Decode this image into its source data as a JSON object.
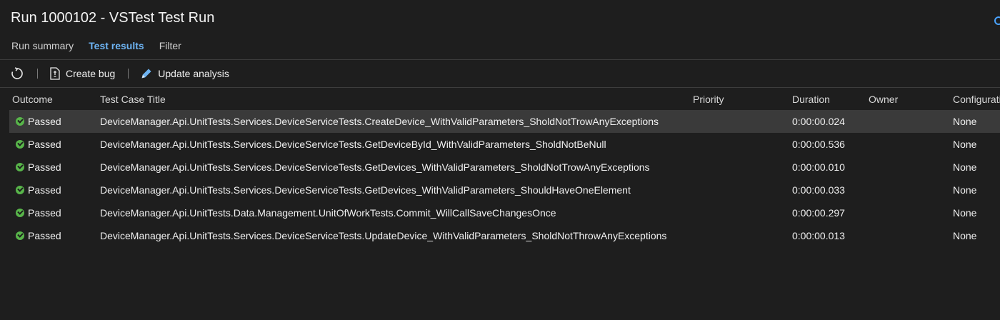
{
  "page": {
    "title": "Run 1000102 - VSTest Test Run"
  },
  "tabs": [
    {
      "label": "Run summary",
      "active": false
    },
    {
      "label": "Test results",
      "active": true
    },
    {
      "label": "Filter",
      "active": false
    }
  ],
  "toolbar": {
    "refresh_icon": "refresh-icon",
    "create_bug_label": "Create bug",
    "create_bug_icon": "bug-icon",
    "update_analysis_label": "Update analysis",
    "update_analysis_icon": "pencil-icon"
  },
  "table": {
    "columns": [
      "Outcome",
      "Test Case Title",
      "Priority",
      "Duration",
      "Owner",
      "Configuratio"
    ],
    "rows": [
      {
        "outcome": "Passed",
        "title": "DeviceManager.Api.UnitTests.Services.DeviceServiceTests.CreateDevice_WithValidParameters_SholdNotTrowAnyExceptions",
        "priority": "",
        "duration": "0:00:00.024",
        "owner": "",
        "configuration": "None",
        "selected": true
      },
      {
        "outcome": "Passed",
        "title": "DeviceManager.Api.UnitTests.Services.DeviceServiceTests.GetDeviceById_WithValidParameters_SholdNotBeNull",
        "priority": "",
        "duration": "0:00:00.536",
        "owner": "",
        "configuration": "None",
        "selected": false
      },
      {
        "outcome": "Passed",
        "title": "DeviceManager.Api.UnitTests.Services.DeviceServiceTests.GetDevices_WithValidParameters_SholdNotTrowAnyExceptions",
        "priority": "",
        "duration": "0:00:00.010",
        "owner": "",
        "configuration": "None",
        "selected": false
      },
      {
        "outcome": "Passed",
        "title": "DeviceManager.Api.UnitTests.Services.DeviceServiceTests.GetDevices_WithValidParameters_ShouldHaveOneElement",
        "priority": "",
        "duration": "0:00:00.033",
        "owner": "",
        "configuration": "None",
        "selected": false
      },
      {
        "outcome": "Passed",
        "title": "DeviceManager.Api.UnitTests.Data.Management.UnitOfWorkTests.Commit_WillCallSaveChangesOnce",
        "priority": "",
        "duration": "0:00:00.297",
        "owner": "",
        "configuration": "None",
        "selected": false
      },
      {
        "outcome": "Passed",
        "title": "DeviceManager.Api.UnitTests.Services.DeviceServiceTests.UpdateDevice_WithValidParameters_SholdNotThrowAnyExceptions",
        "priority": "",
        "duration": "0:00:00.013",
        "owner": "",
        "configuration": "None",
        "selected": false
      }
    ]
  },
  "colors": {
    "background": "#1e1e1e",
    "accent": "#6db3f2",
    "passed": "#58b54a",
    "selected_row": "#3a3a3a"
  }
}
